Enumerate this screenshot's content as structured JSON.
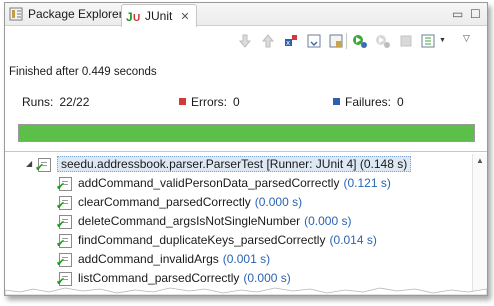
{
  "tabs": [
    {
      "label": "Package Explorer",
      "icon": "package-explorer-icon",
      "active": false
    },
    {
      "label": "JUnit",
      "icon": "junit-icon",
      "active": true
    }
  ],
  "status": {
    "text": "Finished after 0.449 seconds"
  },
  "counters": {
    "runs_label": "Runs:",
    "runs_value": "22/22",
    "errors_label": "Errors:",
    "errors_value": "0",
    "failures_label": "Failures:",
    "failures_value": "0"
  },
  "progress": {
    "fraction": 1.0,
    "color": "#5cbf4a"
  },
  "colors": {
    "error": "#d23a3a",
    "failure": "#2f5fb0",
    "time": "#2a64b3"
  },
  "tree": {
    "root": {
      "name": "seedu.addressbook.parser.ParserTest [Runner: JUnit 4]",
      "time": "(0.148 s)"
    },
    "tests": [
      {
        "name": "addCommand_validPersonData_parsedCorrectly",
        "time": "(0.121 s)"
      },
      {
        "name": "clearCommand_parsedCorrectly",
        "time": "(0.000 s)"
      },
      {
        "name": "deleteCommand_argsIsNotSingleNumber",
        "time": "(0.000 s)"
      },
      {
        "name": "findCommand_duplicateKeys_parsedCorrectly",
        "time": "(0.014 s)"
      },
      {
        "name": "addCommand_invalidArgs",
        "time": "(0.001 s)"
      },
      {
        "name": "listCommand_parsedCorrectly",
        "time": "(0.000 s)"
      }
    ]
  }
}
